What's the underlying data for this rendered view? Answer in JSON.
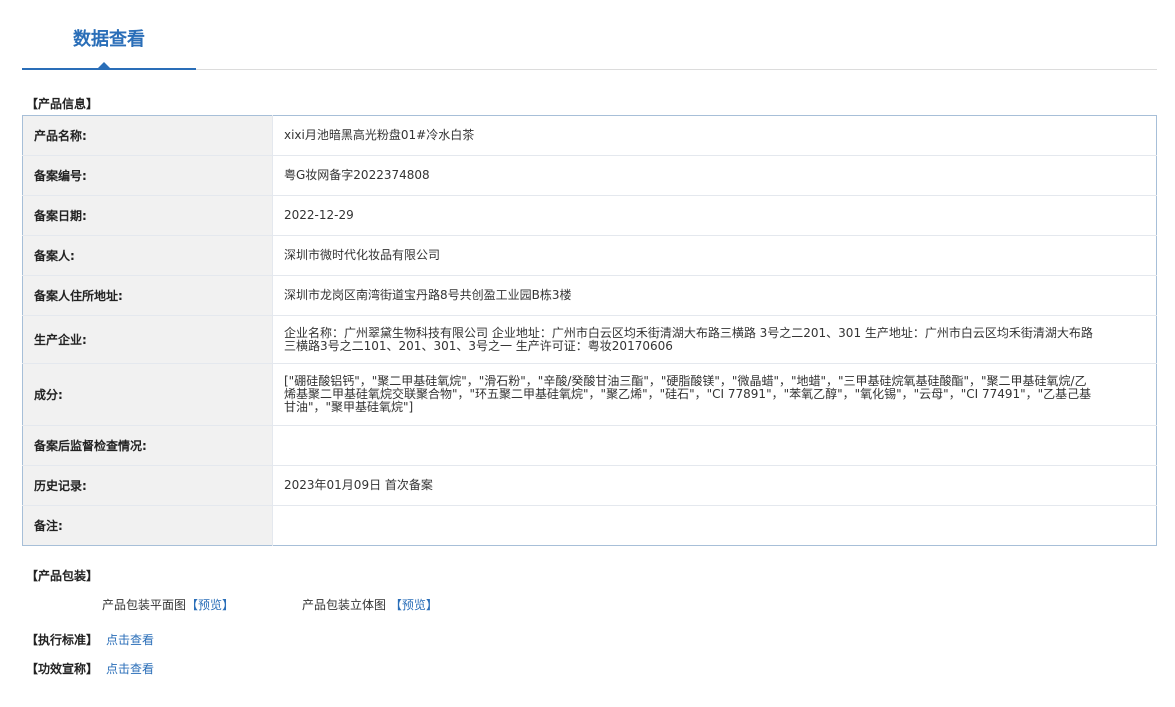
{
  "tab": {
    "title": "数据查看"
  },
  "product_info": {
    "heading": "【产品信息】",
    "rows": [
      {
        "label": "产品名称:",
        "value": "xixi月池暗黑高光粉盘01#冷水白茶"
      },
      {
        "label": "备案编号:",
        "value": "粤G妆网备字2022374808"
      },
      {
        "label": "备案日期:",
        "value": "2022-12-29"
      },
      {
        "label": "备案人:",
        "value": "深圳市微时代化妆品有限公司"
      },
      {
        "label": "备案人住所地址:",
        "value": "深圳市龙岗区南湾街道宝丹路8号共创盈工业园B栋3楼"
      },
      {
        "label": "生产企业:",
        "value": "企业名称：广州翠黛生物科技有限公司 企业地址：广州市白云区均禾街清湖大布路三横路 3号之二201、301 生产地址：广州市白云区均禾街清湖大布路三横路3号之二101、201、301、3号之一 生产许可证：粤妆20170606"
      },
      {
        "label": "成分:",
        "value": "[\"硼硅酸铝钙\"，\"聚二甲基硅氧烷\"，\"滑石粉\"，\"辛酸/癸酸甘油三酯\"，\"硬脂酸镁\"，\"微晶蜡\"，\"地蜡\"，\"三甲基硅烷氧基硅酸酯\"，\"聚二甲基硅氧烷/乙烯基聚二甲基硅氧烷交联聚合物\"，\"环五聚二甲基硅氧烷\"，\"聚乙烯\"，\"硅石\"，\"CI 77891\"，\"苯氧乙醇\"，\"氧化锡\"，\"云母\"，\"CI 77491\"，\"乙基己基甘油\"，\"聚甲基硅氧烷\"]"
      },
      {
        "label": "备案后监督检查情况:",
        "value": ""
      },
      {
        "label": "历史记录:",
        "value": "2023年01月09日 首次备案"
      },
      {
        "label": "备注:",
        "value": ""
      }
    ]
  },
  "packaging": {
    "heading": "【产品包装】",
    "flat_label": "产品包装平面图",
    "flat_link": "【预览】",
    "stereo_label": "产品包装立体图",
    "stereo_link": "【预览】"
  },
  "standard": {
    "heading": "【执行标准】",
    "link": "点击查看"
  },
  "efficacy": {
    "heading": "【功效宣称】",
    "link": "点击查看"
  }
}
